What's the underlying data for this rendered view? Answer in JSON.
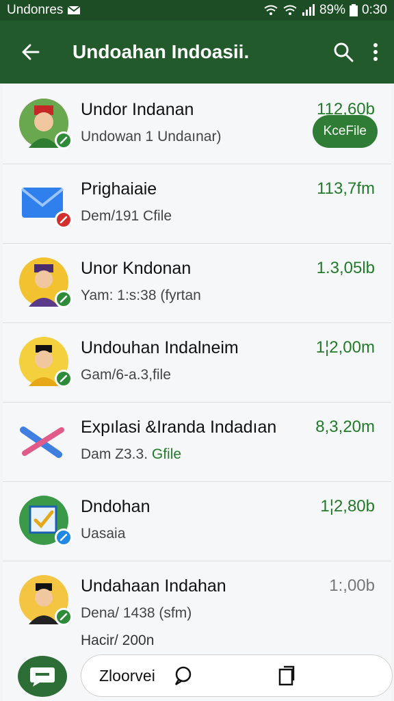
{
  "status": {
    "carrier": "Undonres",
    "battery": "89%",
    "time": "0:30"
  },
  "toolbar": {
    "title": "Undoahan Indoasii."
  },
  "rows": [
    {
      "name": "Undor Indanan",
      "sub": "Undowan 1 Undaınar)",
      "size": "112,60b",
      "pill": "KceFile",
      "badge_color": "#2e8b3a"
    },
    {
      "name": "Prighaiaie",
      "sub": "Dem/191 Cfile",
      "size": "113,7fm",
      "badge_color": "#d32f2f"
    },
    {
      "name": "Unor Kndonan",
      "sub": "Yam: 1:s:38 (fyrtan",
      "size": "1.3,05lb",
      "badge_color": "#2e8b3a"
    },
    {
      "name": "Undouhan Indalneim",
      "sub": "Gam/6-a.3,file",
      "size": "1¦2,00m",
      "badge_color": "#2e8b3a"
    },
    {
      "name": "Expılasi &Iranda Indadıan",
      "sub_a": "Dam Z3.3.",
      "sub_b": "Gfile",
      "size": "8,3,20m"
    },
    {
      "name": "Dndohan",
      "sub": "Uasaia",
      "size": "1¦2,80b",
      "badge_color": "#1e88e5"
    },
    {
      "name": "Undahaan Indahan",
      "sub": "Dena/ 1438 (sfm)",
      "extra": "Hacir/ 200n",
      "size": "1:,00b",
      "badge_color": "#2e8b3a"
    }
  ],
  "bottom": {
    "label": "Zloorvei"
  },
  "colors": {
    "accent": "#235a2c",
    "green_text": "#217a2a"
  }
}
